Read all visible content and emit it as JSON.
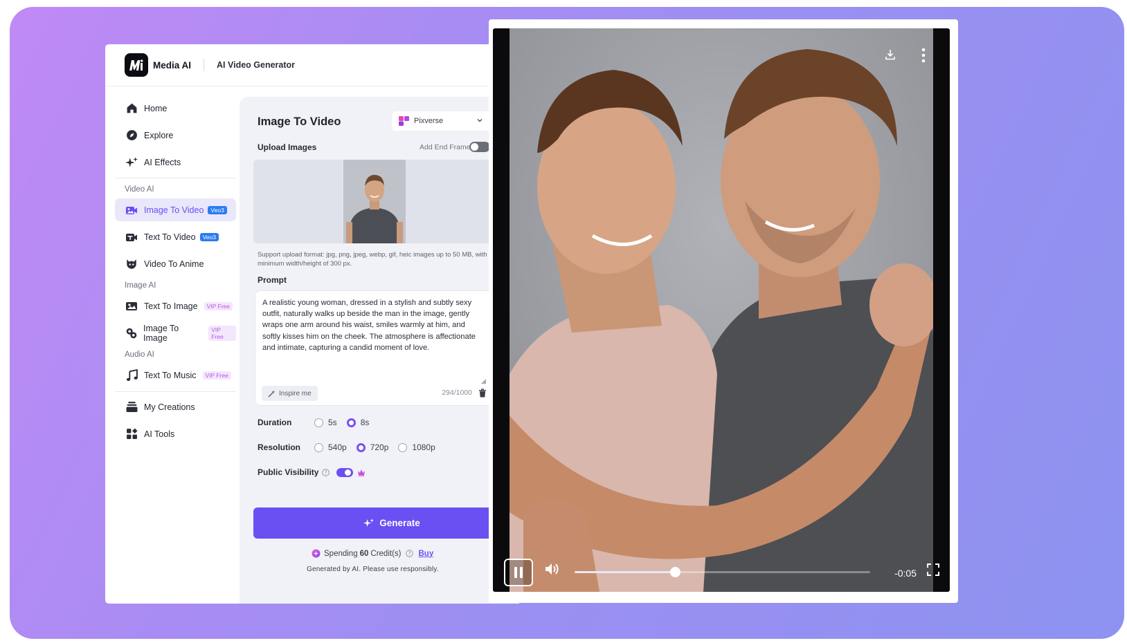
{
  "brand": {
    "name": "Media AI",
    "subtitle": "AI Video Generator"
  },
  "sidebar": {
    "items": [
      {
        "label": "Home",
        "icon": "home-icon"
      },
      {
        "label": "Explore",
        "icon": "compass-icon"
      },
      {
        "label": "AI Effects",
        "icon": "sparkles-icon"
      }
    ],
    "sections": {
      "video": "Video AI",
      "image": "Image AI",
      "audio": "Audio AI"
    },
    "video_items": [
      {
        "label": "Image To Video",
        "badge": "Veo3",
        "icon": "image-video-icon",
        "active": true
      },
      {
        "label": "Text To Video",
        "badge": "Veo3",
        "icon": "text-video-icon"
      },
      {
        "label": "Video To Anime",
        "icon": "anime-icon"
      }
    ],
    "image_items": [
      {
        "label": "Text To Image",
        "badge": "VIP Free",
        "icon": "text-image-icon"
      },
      {
        "label": "Image To Image",
        "badge": "VIP Free",
        "icon": "image-image-icon"
      }
    ],
    "audio_items": [
      {
        "label": "Text To Music",
        "badge": "VIP Free",
        "icon": "music-icon"
      }
    ],
    "bottom_items": [
      {
        "label": "My Creations",
        "icon": "stack-icon"
      },
      {
        "label": "AI Tools",
        "icon": "grid-icon"
      }
    ]
  },
  "panel": {
    "title": "Image To Video",
    "model": "Pixverse",
    "upload_label": "Upload Images",
    "end_frame_label": "Add End Frame",
    "upload_note": "Support upload format: jpg, png, jpeg, webp, gif, heic images up to 50 MB, with a minimum width/height of 300 px.",
    "prompt_label": "Prompt",
    "prompt_text": "A realistic young woman, dressed in a stylish and subtly sexy outfit, naturally walks up beside the man in the image, gently wraps one arm around his waist, smiles warmly at him, and softly kisses him on the cheek. The atmosphere is affectionate and intimate, capturing a candid moment of love.",
    "inspire_label": "Inspire me",
    "char_count": "294/1000",
    "duration_label": "Duration",
    "durations": [
      "5s",
      "8s"
    ],
    "duration_selected": "8s",
    "resolution_label": "Resolution",
    "resolutions": [
      "540p",
      "720p",
      "1080p"
    ],
    "resolution_selected": "720p",
    "visibility_label": "Public Visibility",
    "generate_label": "Generate",
    "spending_prefix": "Spending",
    "spending_amount": "60",
    "spending_suffix": "Credit(s)",
    "buy_label": "Buy",
    "disclaimer": "Generated by AI. Please use responsibly."
  },
  "player": {
    "time_remaining": "-0:05",
    "progress": 0.34
  },
  "colors": {
    "accent": "#6a4ff3",
    "veo_badge": "#2a7cf2",
    "vip_badge": "#b55ae8"
  }
}
